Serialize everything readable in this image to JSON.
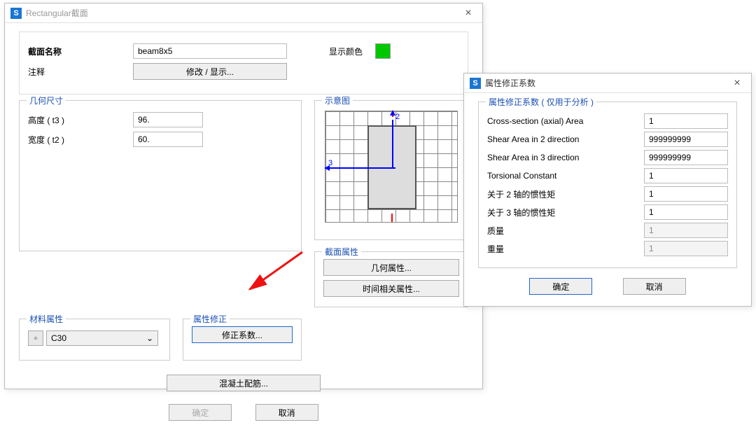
{
  "mainDialog": {
    "title": "Rectangular截面",
    "top": {
      "sectionNameLabel": "截面名称",
      "sectionNameValue": "beam8x5",
      "displayColorLabel": "显示颜色",
      "colorHex": "#00c800",
      "annotationLabel": "注释",
      "modifyShowBtn": "修改 / 显示..."
    },
    "geom": {
      "legend": "几何尺寸",
      "heightLabel": "高度 ( t3 )",
      "heightValue": "96.",
      "widthLabel": "宽度 ( t2 )",
      "widthValue": "60."
    },
    "sketch": {
      "legend": "示意图",
      "axis2": "2",
      "axis3": "3"
    },
    "section": {
      "legend": "截面属性",
      "geomPropBtn": "几何属性...",
      "timePropBtn": "时间相关属性..."
    },
    "material": {
      "legend": "材料属性",
      "value": "C30"
    },
    "modifier": {
      "legend": "属性修正",
      "btn": "修正系数..."
    },
    "rebarBtn": "混凝土配筋...",
    "okBtn": "确定",
    "cancelBtn": "取消"
  },
  "modDialog": {
    "title": "属性修正系数",
    "legend": "属性修正系数 ( 仅用于分析 )",
    "fields": [
      {
        "label": "Cross-section (axial) Area",
        "value": "1",
        "disabled": false
      },
      {
        "label": "Shear Area in 2 direction",
        "value": "999999999",
        "disabled": false
      },
      {
        "label": "Shear Area in 3 direction",
        "value": "999999999",
        "disabled": false
      },
      {
        "label": "Torsional Constant",
        "value": "1",
        "disabled": false
      },
      {
        "label": "关于 2 轴的惯性矩",
        "value": "1",
        "disabled": false
      },
      {
        "label": "关于 3 轴的惯性矩",
        "value": "1",
        "disabled": false
      },
      {
        "label": "质量",
        "value": "1",
        "disabled": true
      },
      {
        "label": "重量",
        "value": "1",
        "disabled": true
      }
    ],
    "okBtn": "确定",
    "cancelBtn": "取消"
  }
}
